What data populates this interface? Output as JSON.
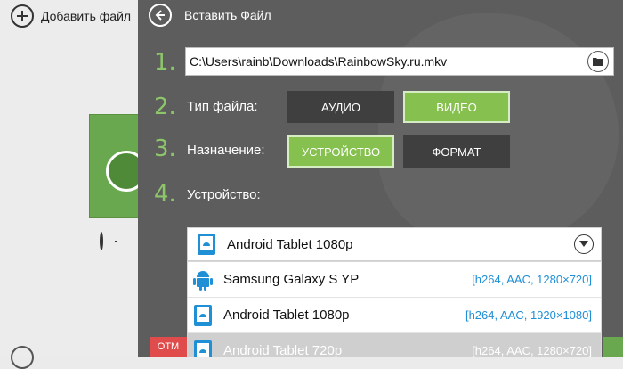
{
  "background_app": {
    "add_file_label": "Добавить файл"
  },
  "dialog": {
    "title": "Вставить Файл",
    "steps": [
      {
        "number": "1.",
        "label": ""
      },
      {
        "number": "2.",
        "label": "Тип файла:"
      },
      {
        "number": "3.",
        "label": "Назначение:"
      },
      {
        "number": "4.",
        "label": "Устройство:"
      }
    ],
    "file_path": "C:\\Users\\rainb\\Downloads\\RainbowSky.ru.mkv",
    "file_type": {
      "audio": "АУДИО",
      "video": "ВИДЕО",
      "selected": "ВИДЕО"
    },
    "destination": {
      "device": "УСТРОЙСТВО",
      "format": "ФОРМАТ",
      "selected": "УСТРОЙСТВО"
    },
    "device": {
      "selected": "Android Tablet 1080p",
      "options": [
        {
          "name": "Samsung Galaxy S YP",
          "spec": "[h264, AAC, 1280×720]"
        },
        {
          "name": "Android Tablet 1080p",
          "spec": "[h264, AAC, 1920×1080]"
        },
        {
          "name": "Android Tablet 720p",
          "spec": "[h264, AAC, 1280×720]"
        }
      ]
    },
    "bottom_cancel_partial": "ОТМ"
  },
  "colors": {
    "accent_green": "#86c04e",
    "panel_bg": "#5d5d5d",
    "spec_blue": "#1f8fd6"
  }
}
